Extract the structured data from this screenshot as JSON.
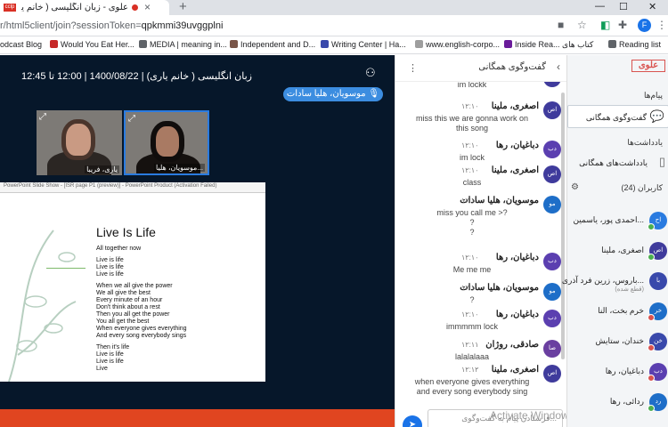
{
  "browser": {
    "tab_title": "علوی - زبان انگلیسی ( خانم یار...",
    "favicon_text": "cclp",
    "url_path": "r/html5client/join?sessionToken=",
    "url_token": "qpkmmi39uvggplni",
    "profile_initial": "F",
    "bookmarks": [
      {
        "label": "odcast Blog",
        "color": "#9e9e9e"
      },
      {
        "label": "Would You Eat Her...",
        "color": "#c62828"
      },
      {
        "label": "MEDIA | meaning in...",
        "color": "#5f6368"
      },
      {
        "label": "Independent and D...",
        "color": "#795548"
      },
      {
        "label": "Writing Center | Ha...",
        "color": "#3949ab"
      },
      {
        "label": "www.english-corpo...",
        "color": "#5f6368"
      },
      {
        "label": "Inside Rea... کتاب های",
        "color": "#6a1b9a"
      },
      {
        "label": "Reading list",
        "color": "#5f6368"
      }
    ]
  },
  "meeting": {
    "title": "زبان انگلیسی ( خانم یاری) | 1400/08/22 | 12:00 تا 12:45",
    "talker": "موسویان، هلیا سادات",
    "cams": [
      {
        "name": "یاری، فریبا",
        "active": false
      },
      {
        "name": "موسویان، هلیا...",
        "active": true
      }
    ]
  },
  "presentation": {
    "toolbar_text": "PowerPoint Slide Show - [ISR page P1 (preview)] - PowerPoint Product (Activation Failed)",
    "slide_title": "Live Is Life",
    "slide_subtitle": "All together now",
    "lyrics": [
      [
        "Live is life",
        "Live is life",
        "Live is life"
      ],
      [
        "When we all give the power",
        "We all give the best",
        "Every minute of an hour",
        "Don't think about a rest",
        "Then you all get the power",
        "You all get the best",
        "When everyone gives everything",
        "And every song everybody sings"
      ],
      [
        "Then it's life",
        "Live is life",
        "Live is life",
        "Live"
      ]
    ]
  },
  "chat": {
    "title": "گفت‌وگوی همگانی",
    "input_placeholder": "فرستادن پیام به گفت‌وگوی...",
    "activate_text": "Activate Windows",
    "messages": [
      {
        "initials": "",
        "name": "",
        "time": "",
        "lines": [
          "im lockk"
        ],
        "color": "#3f3b9c"
      },
      {
        "initials": "اص",
        "name": "اصغری، ملینا",
        "time": "۱۲:۱۰",
        "lines": [
          "miss this we are gonna work on",
          "this song"
        ],
        "color": "#3f3b9c"
      },
      {
        "initials": "دب",
        "name": "دباغیان، رها",
        "time": "۱۲:۱۰",
        "lines": [
          "im lock"
        ],
        "color": "#5b3fb0"
      },
      {
        "initials": "اص",
        "name": "اصغری، ملینا",
        "time": "۱۲:۱۰",
        "lines": [
          "class"
        ],
        "color": "#3f3b9c"
      },
      {
        "initials": "مو",
        "name": "موسویان، هلیا سادات",
        "time": "۱۲:۱۰",
        "lines": [
          "miss you call me >?",
          "?",
          "?"
        ],
        "color": "#1e6ec8"
      },
      {
        "initials": "دب",
        "name": "دباغیان، رها",
        "time": "۱۲:۱۰",
        "lines": [
          "Me me me"
        ],
        "color": "#5b3fb0"
      },
      {
        "initials": "مو",
        "name": "موسویان، هلیا سادات",
        "time": "۱۲:۱۰",
        "lines": [
          "?"
        ],
        "color": "#1e6ec8"
      },
      {
        "initials": "دب",
        "name": "دباغیان، رها",
        "time": "۱۲:۱۰",
        "lines": [
          "immmmm lock"
        ],
        "color": "#5b3fb0"
      },
      {
        "initials": "صا",
        "name": "صادقی، روژان",
        "time": "۱۲:۱۱",
        "lines": [
          "lalalalaaa"
        ],
        "color": "#6a3fa0"
      },
      {
        "initials": "اص",
        "name": "اصغری، ملینا",
        "time": "۱۲:۱۲",
        "lines": [
          "when everyone gives everything",
          "and every song everybody sing"
        ],
        "color": "#3f3b9c"
      }
    ]
  },
  "sidebar": {
    "brand": "علوی",
    "messages_header": "پیام‌ها",
    "public_chat": "گفت‌وگوی همگانی",
    "notes_header": "یادداشت‌ها",
    "shared_notes": "یادداشت‌های همگانی",
    "users_header": "کاربران (24)",
    "users": [
      {
        "initials": "اح",
        "name": "احمدی پور، یاسمین...",
        "sub": "",
        "color": "#2a7be0",
        "mic": "#4caf50"
      },
      {
        "initials": "اص",
        "name": "اصغری، ملینا",
        "sub": "",
        "color": "#3f3b9c",
        "mic": "#4caf50"
      },
      {
        "initials": "با",
        "name": "باروس، زرین فرد آذری...",
        "sub": "(قطع شده)",
        "color": "#3949ab",
        "mic": ""
      },
      {
        "initials": "خر",
        "name": "خرم بخت، النا",
        "sub": "",
        "color": "#1e6ec8",
        "mic": "#d9534f"
      },
      {
        "initials": "خن",
        "name": "خندان، ستایش",
        "sub": "",
        "color": "#3949ab",
        "mic": "#d9534f"
      },
      {
        "initials": "دب",
        "name": "دباغیان، رها",
        "sub": "",
        "color": "#5b3fb0",
        "mic": "#d9534f"
      },
      {
        "initials": "رد",
        "name": "ردائی، رها",
        "sub": "",
        "color": "#1e6ec8",
        "mic": "#4caf50"
      }
    ]
  }
}
